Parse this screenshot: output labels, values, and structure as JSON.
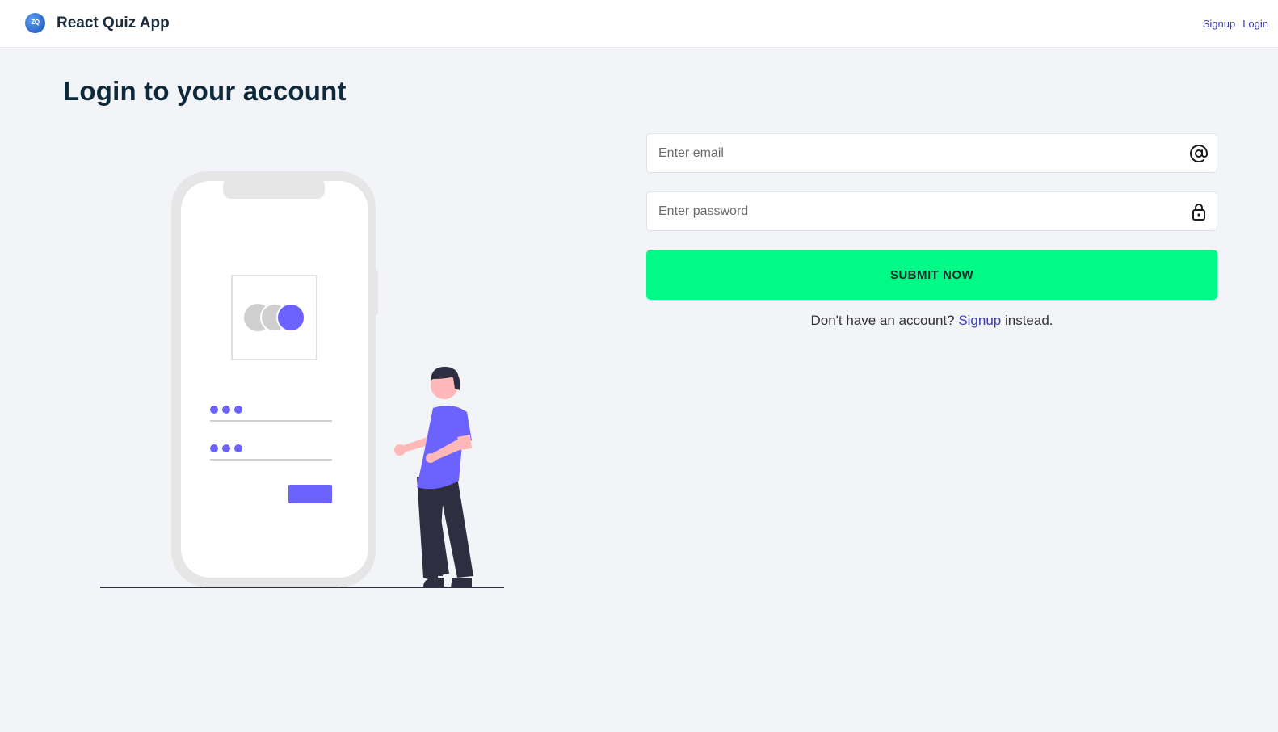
{
  "navbar": {
    "logo_text": "ZQ",
    "brand_name": "React Quiz App",
    "links": [
      {
        "label": "Signup"
      },
      {
        "label": "Login"
      }
    ]
  },
  "page": {
    "title": "Login to your account"
  },
  "form": {
    "email_placeholder": "Enter email",
    "email_icon": "at-sign-icon",
    "password_placeholder": "Enter password",
    "password_icon": "lock-icon",
    "submit_label": "SUBMIT NOW",
    "signup_prompt_before": "Don't have an account? ",
    "signup_link_label": "Signup",
    "signup_prompt_after": " instead."
  },
  "colors": {
    "accent": "#00fa87",
    "link": "#3b3db0",
    "illustration_purple": "#6c63ff",
    "background": "#f3f4f8"
  }
}
